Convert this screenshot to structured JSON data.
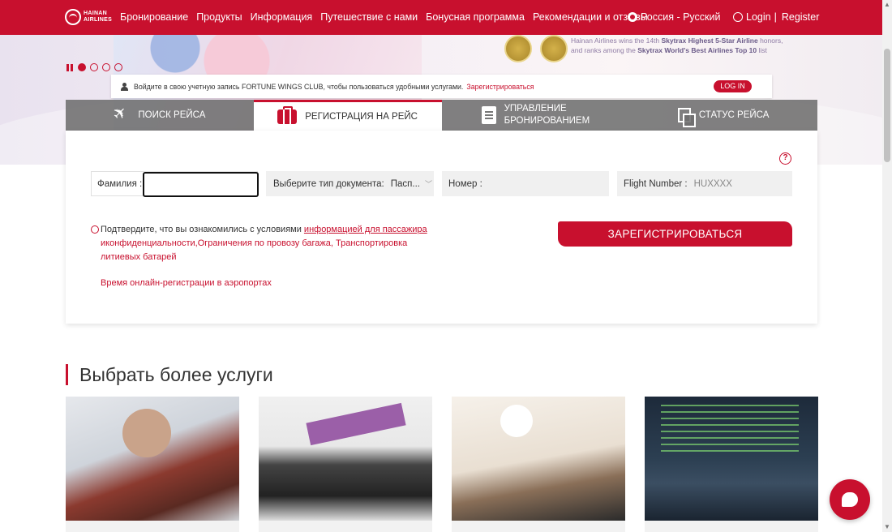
{
  "brand": {
    "logo_text_1": "HAINAN",
    "logo_text_2": "AIRLINES"
  },
  "nav": [
    "Бронирование",
    "Продукты",
    "Информация",
    "Путешествие с нами",
    "Бонусная программа",
    "Рекомендации и отзывы"
  ],
  "language": "Россия - Русский",
  "auth": {
    "login": "Login",
    "separator": "|",
    "register": "Register"
  },
  "banner": {
    "line1_pre": "Hainan Airlines wins the 14th ",
    "line1_bold": "Skytrax Highest 5-Star Airline",
    "line1_post": " honors,",
    "line2_pre": "and ranks among the ",
    "line2_bold": "Skytrax World's  Best Airlines Top 10",
    "line2_post": " list"
  },
  "login_strip": {
    "message": "Войдите в свою учетную запись FORTUNE WINGS CLUB, чтобы пользоваться удобными услугами.",
    "register_link": "Зарегистрироваться",
    "login_button": "LOG IN"
  },
  "tabs": [
    {
      "label": "ПОИСК РЕЙСА",
      "icon": "plane-icon"
    },
    {
      "label": "РЕГИСТРАЦИЯ НА РЕЙС",
      "icon": "luggage-icon"
    },
    {
      "label": "УПРАВЛЕНИЕ",
      "label2": "БРОНИРОВАНИЕМ",
      "icon": "clipboard-icon"
    },
    {
      "label": "СТАТУС РЕЙСА",
      "icon": "document-icon"
    }
  ],
  "form": {
    "help": "?",
    "surname_label": "Фамилия :",
    "surname_value": "",
    "doctype_label": "Выберите тип документа:",
    "doctype_value": "Пасп...",
    "number_label": "Номер :",
    "flight_label": "Flight Number :",
    "flight_placeholder": "HUXXXX",
    "consent_text": "Подтвердите, что вы ознакомились с условиями ",
    "consent_link": "информацией для пассажира",
    "consent_rest": "иконфиденциальности,Ограничения по провозу багажа, Транспортировка литиевых батарей",
    "checkin_times": "Время онлайн-регистрации в аэропортах",
    "submit": "ЗАРЕГИСТРИРОВАТЬСЯ"
  },
  "services": {
    "title": "Выбрать более услуги"
  },
  "colors": {
    "brand_red": "#c8102e",
    "tab_gray": "#6e6e6e"
  }
}
